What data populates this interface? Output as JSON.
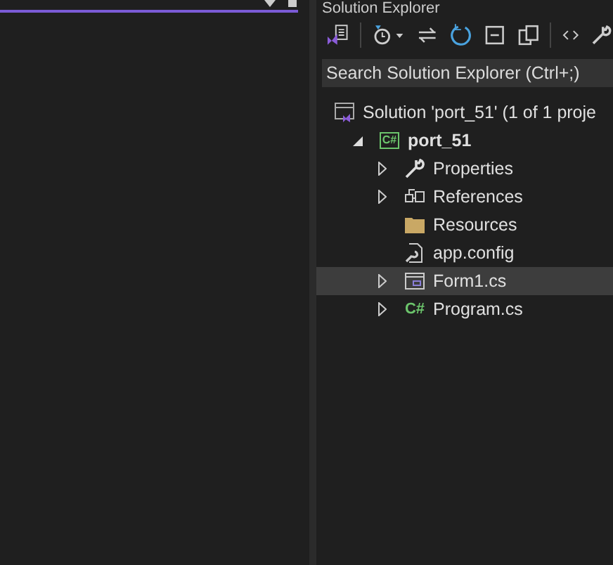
{
  "panel": {
    "title": "Solution Explorer",
    "search": {
      "placeholder": "Search Solution Explorer (Ctrl+;)"
    }
  },
  "tree": [
    {
      "label": "Solution 'port_51' (1 of 1 proje",
      "kind": "solution",
      "selected": false,
      "children": [
        {
          "label": "port_51",
          "kind": "csproj",
          "badge": "C#",
          "bold": true,
          "selected": false,
          "expanded": true,
          "children": [
            {
              "label": "Properties",
              "kind": "wrench",
              "selected": false,
              "expanded": false,
              "has_children": true
            },
            {
              "label": "References",
              "kind": "references",
              "selected": false,
              "expanded": false,
              "has_children": true
            },
            {
              "label": "Resources",
              "kind": "folder",
              "selected": false,
              "has_children": false
            },
            {
              "label": "app.config",
              "kind": "config",
              "selected": false,
              "has_children": false
            },
            {
              "label": "Form1.cs",
              "kind": "form",
              "selected": true,
              "expanded": false,
              "has_children": true
            },
            {
              "label": "Program.cs",
              "kind": "csfile",
              "badge": "C#",
              "selected": false,
              "expanded": false,
              "has_children": true
            }
          ]
        }
      ]
    }
  ]
}
